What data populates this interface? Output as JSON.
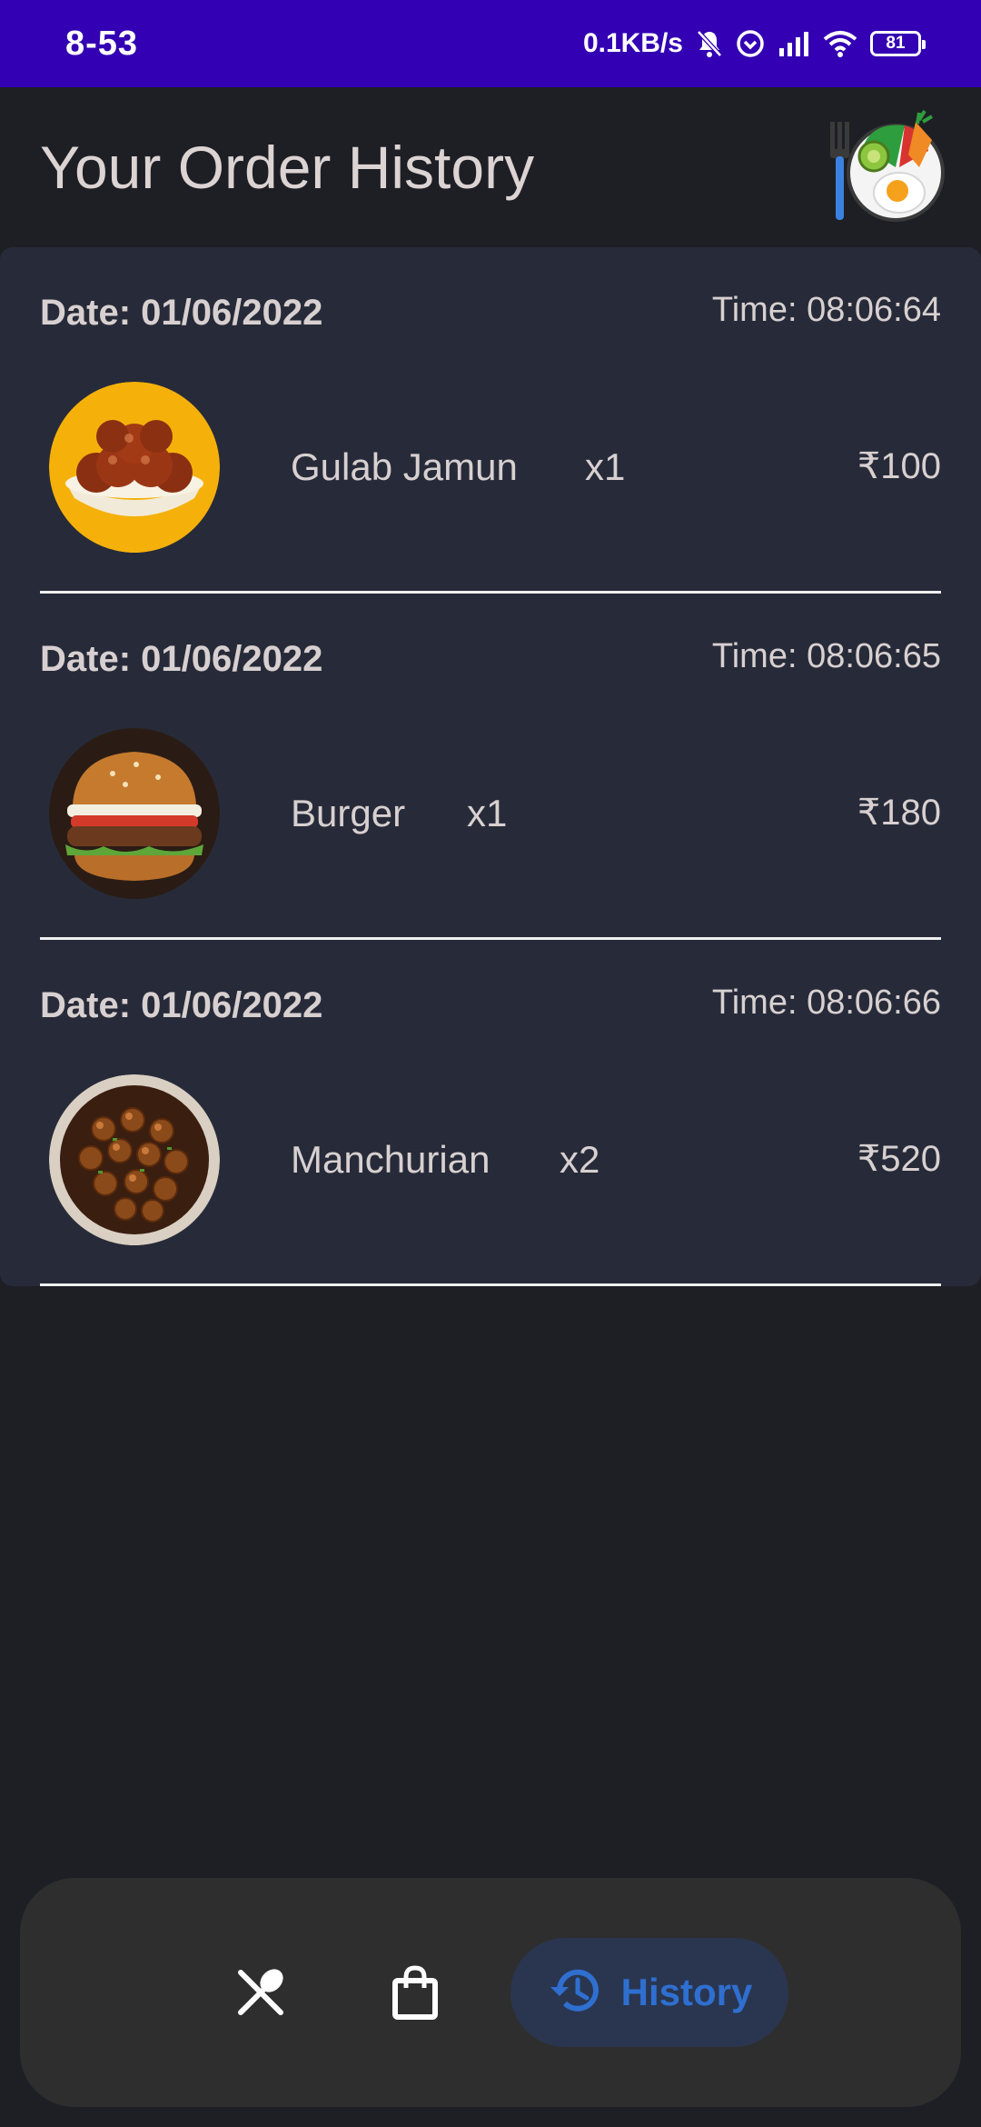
{
  "status_bar": {
    "time": "8-53",
    "network_speed": "0.1KB/s",
    "battery": "81"
  },
  "header": {
    "title": "Your Order History",
    "logo_icon": "food-plate-logo-icon"
  },
  "orders": [
    {
      "date": "Date: 01/06/2022",
      "time": "Time: 08:06:64",
      "item": "Gulab Jamun",
      "qty": "x1",
      "price": "₹100",
      "image_icon": "gulab-jamun-image"
    },
    {
      "date": "Date: 01/06/2022",
      "time": "Time: 08:06:65",
      "item": "Burger",
      "qty": "x1",
      "price": "₹180",
      "image_icon": "burger-image"
    },
    {
      "date": "Date: 01/06/2022",
      "time": "Time: 08:06:66",
      "item": "Manchurian",
      "qty": "x2",
      "price": "₹520",
      "image_icon": "manchurian-image"
    }
  ],
  "bottom_nav": {
    "menu_icon": "fork-spoon-icon",
    "cart_icon": "shopping-bag-icon",
    "history_icon": "history-icon",
    "history_label": "History",
    "active": "History"
  },
  "colors": {
    "status_bar": "#3300b3",
    "background": "#1e1f25",
    "card": "#272b39",
    "nav_bar": "#2e2e2e",
    "accent": "#2f6fd0"
  }
}
